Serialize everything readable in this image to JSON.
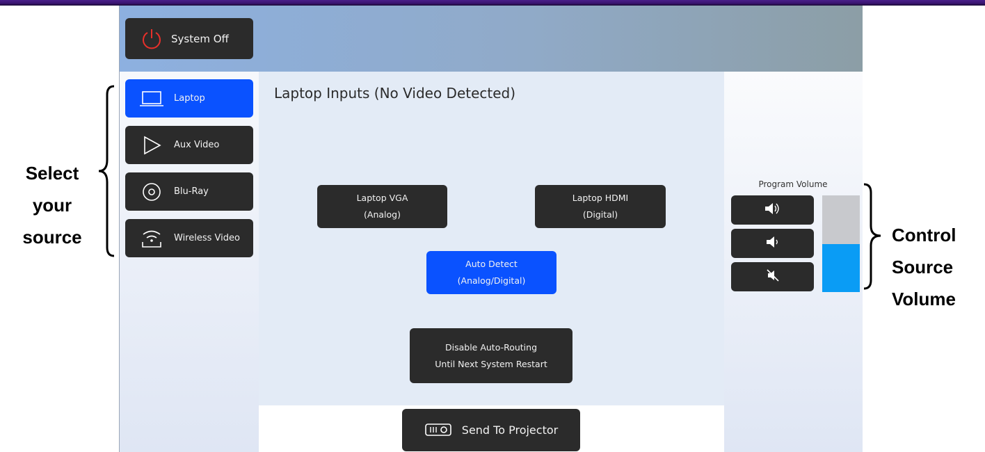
{
  "header": {
    "system_off_label": "System Off"
  },
  "sources": [
    {
      "label": "Laptop",
      "icon": "laptop-icon",
      "active": true
    },
    {
      "label": "Aux Video",
      "icon": "play-icon",
      "active": false
    },
    {
      "label": "Blu-Ray",
      "icon": "disc-icon",
      "active": false
    },
    {
      "label": "Wireless Video",
      "icon": "wireless-icon",
      "active": false
    }
  ],
  "content": {
    "title": "Laptop Inputs (No Video Detected)",
    "vga": {
      "line1": "Laptop VGA",
      "line2": "(Analog)"
    },
    "hdmi": {
      "line1": "Laptop HDMI",
      "line2": "(Digital)"
    },
    "auto": {
      "line1": "Auto Detect",
      "line2": "(Analog/Digital)"
    },
    "disable": {
      "line1": "Disable Auto-Routing",
      "line2": "Until Next System Restart"
    },
    "send_label": "Send To Projector"
  },
  "volume": {
    "title": "Program Volume",
    "level": 0.5,
    "fill_color": "#0a9cf5",
    "buttons": [
      "volume-up-icon",
      "volume-down-icon",
      "mute-icon"
    ]
  },
  "annotations": {
    "left": [
      "Select",
      "your",
      "source"
    ],
    "right": [
      "Control",
      "Source",
      "Volume"
    ]
  },
  "colors": {
    "active": "#0a52ff",
    "button": "#2b2b2b",
    "power": "#e8302a"
  }
}
